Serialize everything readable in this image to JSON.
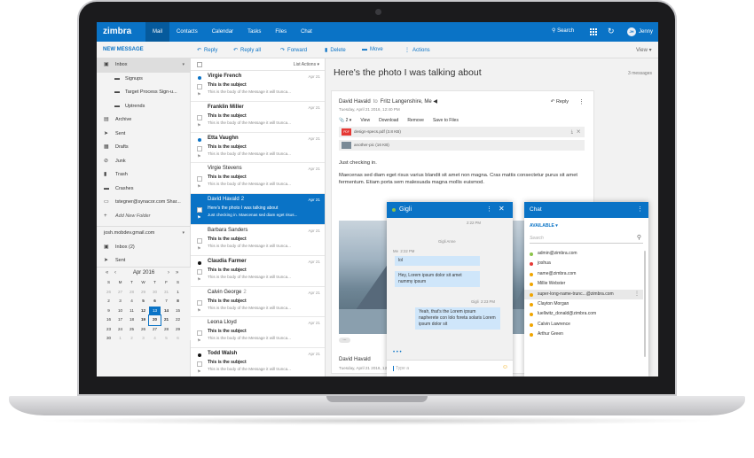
{
  "topbar": {
    "logo": "zimbra",
    "tabs": [
      "Mail",
      "Contacts",
      "Calendar",
      "Tasks",
      "Files",
      "Chat"
    ],
    "search_label": "Search",
    "user_initials": "JH",
    "user_name": "Jenny"
  },
  "toolbar": {
    "new_message": "NEW MESSAGE",
    "reply": "Reply",
    "reply_all": "Reply all",
    "forward": "Forward",
    "delete": "Delete",
    "move": "Move",
    "actions": "Actions",
    "view": "View"
  },
  "sidebar": {
    "folders": [
      {
        "label": "Inbox",
        "icon": "inbox-icon",
        "type": "top",
        "selected": true
      },
      {
        "label": "Signups",
        "icon": "folder-icon",
        "type": "sub"
      },
      {
        "label": "Target Process Sign-u...",
        "icon": "folder-icon",
        "type": "sub"
      },
      {
        "label": "Uptrends",
        "icon": "folder-icon",
        "type": "sub"
      },
      {
        "label": "Archive",
        "icon": "archive-icon",
        "type": "top"
      },
      {
        "label": "Sent",
        "icon": "send-icon",
        "type": "top"
      },
      {
        "label": "Drafts",
        "icon": "drafts-icon",
        "type": "top"
      },
      {
        "label": "Junk",
        "icon": "junk-icon",
        "type": "top"
      },
      {
        "label": "Trash",
        "icon": "trash-icon",
        "type": "top"
      },
      {
        "label": "Crashes",
        "icon": "folder-icon",
        "type": "top"
      },
      {
        "label": "tstegner@synacor.com Shar...",
        "icon": "shared-folder-icon",
        "type": "top"
      },
      {
        "label": "Add New Folder",
        "icon": "plus-icon",
        "type": "add"
      }
    ],
    "account2": "josh.mobdev.gmail.com",
    "account2_folders": [
      {
        "label": "Inbox (2)",
        "icon": "inbox-icon"
      },
      {
        "label": "Sent",
        "icon": "send-icon"
      },
      {
        "label": "Junk",
        "icon": "junk-icon"
      }
    ]
  },
  "calendar": {
    "month": "Apr 2016",
    "weekdays": [
      "S",
      "M",
      "T",
      "W",
      "T",
      "F",
      "S"
    ],
    "days": [
      "26",
      "27",
      "28",
      "29",
      "30",
      "31",
      "1",
      "2",
      "3",
      "4",
      "5",
      "6",
      "7",
      "8",
      "9",
      "10",
      "11",
      "12",
      "13",
      "14",
      "15",
      "16",
      "17",
      "18",
      "19",
      "20",
      "21",
      "22",
      "23",
      "24",
      "25",
      "26",
      "27",
      "28",
      "29",
      "30",
      "1",
      "2",
      "3",
      "4",
      "5",
      "6"
    ],
    "dim_indices": [
      0,
      1,
      2,
      3,
      4,
      5,
      36,
      37,
      38,
      39,
      40,
      41
    ],
    "bold_indices": [
      10,
      11,
      13,
      17,
      19,
      24,
      25,
      26
    ],
    "today_index": 18,
    "selected_index": 25
  },
  "messages": {
    "list_actions": "List Actions",
    "items": [
      {
        "from": "Virgie French",
        "subject": "This is the subject",
        "preview": "This is the body of the Message it will trunca...",
        "date": "Apr 21",
        "unread": true,
        "dot": "#0a73c6",
        "count": ""
      },
      {
        "from": "Franklin Miller",
        "subject": "This is the subject",
        "preview": "This is the body of the Message it will trunca...",
        "date": "Apr 21",
        "unread": true,
        "dot": "",
        "count": ""
      },
      {
        "from": "Etta Vaughn",
        "subject": "This is the subject",
        "preview": "This is the body of the Message it will trunca...",
        "date": "Apr 21",
        "unread": true,
        "dot": "#0a73c6",
        "count": ""
      },
      {
        "from": "Virgie Stevens",
        "subject": "This is the subject",
        "preview": "This is the body of the Message it will trunca...",
        "date": "Apr 21",
        "unread": false,
        "dot": "",
        "count": ""
      },
      {
        "from": "David Havald",
        "subject": "Here's the photo I was talking about",
        "preview": "Just checking in. Maecenas sed diam eget risus...",
        "date": "Apr 21",
        "unread": false,
        "dot": "",
        "count": "2",
        "selected": true
      },
      {
        "from": "Barbara Sanders",
        "subject": "This is the subject",
        "preview": "This is the body of the Message it will trunca...",
        "date": "Apr 21",
        "unread": false,
        "dot": "",
        "count": ""
      },
      {
        "from": "Claudia Farmer",
        "subject": "This is the subject",
        "preview": "This is the body of the Message it will trunca...",
        "date": "Apr 21",
        "unread": true,
        "dot": "#111",
        "count": ""
      },
      {
        "from": "Calvin George",
        "subject": "This is the subject",
        "preview": "This is the body of the Message it will trunca...",
        "date": "Apr 21",
        "unread": false,
        "dot": "",
        "count": "2"
      },
      {
        "from": "Leona Lloyd",
        "subject": "This is the subject",
        "preview": "This is the body of the Message it will trunca...",
        "date": "Apr 21",
        "unread": false,
        "dot": "",
        "count": ""
      },
      {
        "from": "Todd Walsh",
        "subject": "This is the subject",
        "preview": "This is the body of the Message it will trunca...",
        "date": "Apr 21",
        "unread": true,
        "dot": "#111",
        "count": ""
      }
    ]
  },
  "reading": {
    "subject": "Here's the photo I was talking about",
    "count": "3 messages",
    "from": "David Havald",
    "to_word": "to",
    "to": "Fritz Langenshire, Me",
    "date": "Tuesday, April 21 2016, 12:40 PM",
    "reply": "Reply",
    "attach_count": "2",
    "actions": [
      "View",
      "Download",
      "Remove",
      "Save to Files"
    ],
    "attachments": [
      {
        "name": "design-specs.pdf (3.8 KB)",
        "badge": "PDF",
        "color": "#e53935"
      },
      {
        "name": "another-pic (16 KB)",
        "badge": "",
        "color": "#7a8a96"
      }
    ],
    "body1": "Just checking in.",
    "body2": "Maecenas sed diam eget risus varius blandit sit amet non magna. Cras mattis consectetur purus sit amet fermentum. Etiam porta sem malesuada magna mollis euismod.",
    "from2": "David Havald",
    "date2": "Tuesday, April 21 2016, 12:40 PM"
  },
  "gigli": {
    "name": "Gigli",
    "meta1": "2:22 PM",
    "meta_center": "Gigli Anne",
    "meta_me": "Me",
    "meta_me_time": "2:22 PM",
    "msg1": "lol",
    "msg2": "Hey, Lorem ipsum dolor sit amet nummy ipsum",
    "meta_gigli": "Gigli",
    "meta_gigli_time": "2:23 PM",
    "msg3": "Yeah, that's the Lorem ipsum napherete con lolo foreta solaris Lorem ipsum dolor sit",
    "typing": "• • •",
    "input_placeholder": "Type a"
  },
  "chat": {
    "title": "Chat",
    "status": "AVAILABLE",
    "search_placeholder": "Search",
    "contacts": [
      {
        "name": "admin@zimbra.com",
        "status": "#8bc34a"
      },
      {
        "name": "joshua",
        "status": "#e53935"
      },
      {
        "name": "name@zimbra.com",
        "status": "#f0a500"
      },
      {
        "name": "Millie Webster",
        "status": "#f0a500"
      },
      {
        "name": "super-long-name-trunc...@zimbra.com",
        "status": "#f0a500",
        "selected": true
      },
      {
        "name": "Clayton Morgan",
        "status": "#f0a500"
      },
      {
        "name": "luellwitz_donald@zimbra.com",
        "status": "#f0a500"
      },
      {
        "name": "Calvin Lawrence",
        "status": "#f0a500"
      },
      {
        "name": "Arthur Green",
        "status": "#f0a500"
      }
    ]
  },
  "colors": {
    "brand": "#0a73c6",
    "online": "#8bc34a",
    "busy": "#e53935",
    "away": "#f0a500"
  }
}
